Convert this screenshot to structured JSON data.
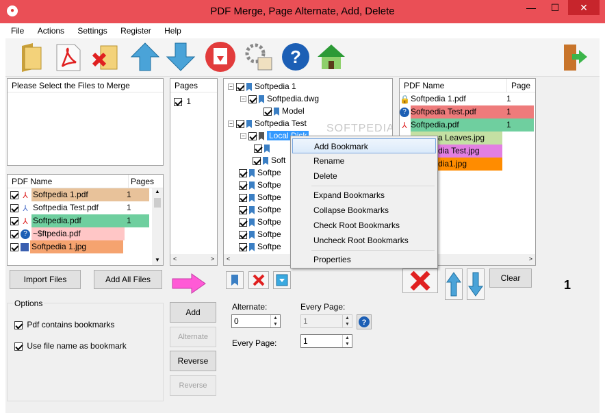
{
  "window": {
    "title": "PDF Merge, Page Alternate, Add, Delete",
    "min": "—",
    "max": "☐",
    "close": "✕"
  },
  "menu": [
    "File",
    "Actions",
    "Settings",
    "Register",
    "Help"
  ],
  "files_panel": {
    "header": "Please Select the Files to Merge"
  },
  "list_panel": {
    "col_name": "PDF Name",
    "col_pages": "Pages",
    "rows": [
      {
        "name": "Softpedia 1.pdf",
        "pages": "1",
        "color": "#e8c29a"
      },
      {
        "name": "Softpedia Test.pdf",
        "pages": "1",
        "color": "#ffffff"
      },
      {
        "name": "Softpedia.pdf",
        "pages": "1",
        "color": "#6fcf9f"
      },
      {
        "name": "~$ftpedia.pdf",
        "pages": "",
        "color": "#ffc6c6"
      },
      {
        "name": "Softpedia 1.jpg",
        "pages": "",
        "color": "#f5a36f"
      }
    ]
  },
  "pages_panel": {
    "header": "Pages",
    "items": [
      "1"
    ]
  },
  "tree": [
    {
      "label": "Softpedia 1"
    },
    {
      "label": "Softpedia.dwg"
    },
    {
      "label": "Model"
    },
    {
      "label": "Softpedia Test"
    },
    {
      "label": "Local Disk"
    },
    {
      "label": ""
    },
    {
      "label": "Soft"
    },
    {
      "label": "Softpe"
    },
    {
      "label": "Softpe"
    },
    {
      "label": "Softpe"
    },
    {
      "label": "Softpe"
    },
    {
      "label": "Softpe"
    },
    {
      "label": "Softpe"
    },
    {
      "label": "Softpe"
    }
  ],
  "watermark": "SOFTPEDIA",
  "right_panel": {
    "col_name": "PDF Name",
    "col_page": "Page",
    "rows": [
      {
        "name": "Softpedia 1.pdf",
        "page": "1",
        "color": "#ffffff"
      },
      {
        "name": "Softpedia Test.pdf",
        "page": "1",
        "color": "#ee7b7b"
      },
      {
        "name": "Softpedia.pdf",
        "page": "1",
        "color": "#6fcf9f"
      },
      {
        "name": "a Leaves.jpg",
        "page": "",
        "color": "#c4e0a3"
      },
      {
        "name": "dia Test.jpg",
        "page": "",
        "color": "#e27fe2"
      },
      {
        "name": "dia1.jpg",
        "page": "",
        "color": "#ff8c00"
      }
    ]
  },
  "context_menu": {
    "items": [
      "Add Bookmark",
      "Rename",
      "Delete",
      "Expand Bookmarks",
      "Collapse Bookmarks",
      "Check Root Bookmarks",
      "Uncheck Root Bookmarks",
      "Properties"
    ]
  },
  "buttons": {
    "import": "Import Files",
    "add_all": "Add All Files",
    "add": "Add",
    "alternate": "Alternate",
    "reverse": "Reverse",
    "reverse2": "Reverse",
    "clear": "Clear"
  },
  "options": {
    "title": "Options",
    "opt1": "Pdf contains bookmarks",
    "opt2": "Use file name as bookmark"
  },
  "alternate": {
    "label": "Alternate:",
    "value": "0",
    "every_label": "Every Page:",
    "every_value": "1",
    "every2_label": "Every Page:",
    "every2_value": "1"
  },
  "count": "1",
  "colors": {
    "title_bg": "#ea4f56",
    "highlight": "#3399ff"
  }
}
